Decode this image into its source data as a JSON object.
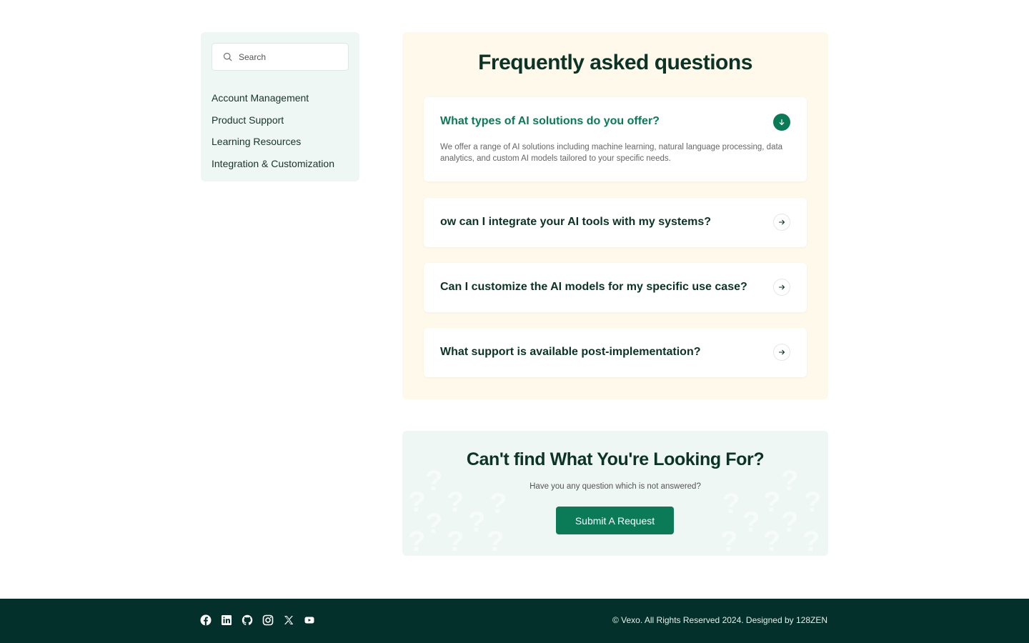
{
  "sidebar": {
    "search_placeholder": "Search",
    "categories": [
      {
        "label": "Account Management"
      },
      {
        "label": "Product Support"
      },
      {
        "label": "Learning Resources"
      },
      {
        "label": "Integration & Customization"
      }
    ]
  },
  "faq": {
    "title": "Frequently asked questions",
    "items": [
      {
        "question": "What types of AI solutions do you offer?",
        "answer": "We offer a range of AI solutions including machine learning, natural language processing, data analytics, and custom AI models tailored to your specific needs.",
        "expanded": true,
        "icon": "arrow-down-icon"
      },
      {
        "question": "ow can I integrate your AI tools with my systems?",
        "expanded": false,
        "icon": "arrow-right-icon"
      },
      {
        "question": "Can I customize the AI models for my specific use case?",
        "expanded": false,
        "icon": "arrow-right-icon"
      },
      {
        "question": "What support is available post-implementation?",
        "expanded": false,
        "icon": "arrow-right-icon"
      }
    ]
  },
  "help": {
    "title": "Can't find What You're Looking For?",
    "subtitle": "Have you any question which is not answered?",
    "button_label": "Submit A Request"
  },
  "footer": {
    "social_icons": [
      "facebook-icon",
      "linkedin-icon",
      "github-icon",
      "instagram-icon",
      "x-icon",
      "youtube-icon"
    ],
    "copyright": "© Vexo. All Rights Reserved 2024. Designed by 128ZEN"
  },
  "colors": {
    "accent": "#0b7a57",
    "heading": "#0b3326",
    "faq_panel_bg": "#fef9ea",
    "mint_bg": "#eef7f3",
    "footer_bg": "#03302a"
  }
}
